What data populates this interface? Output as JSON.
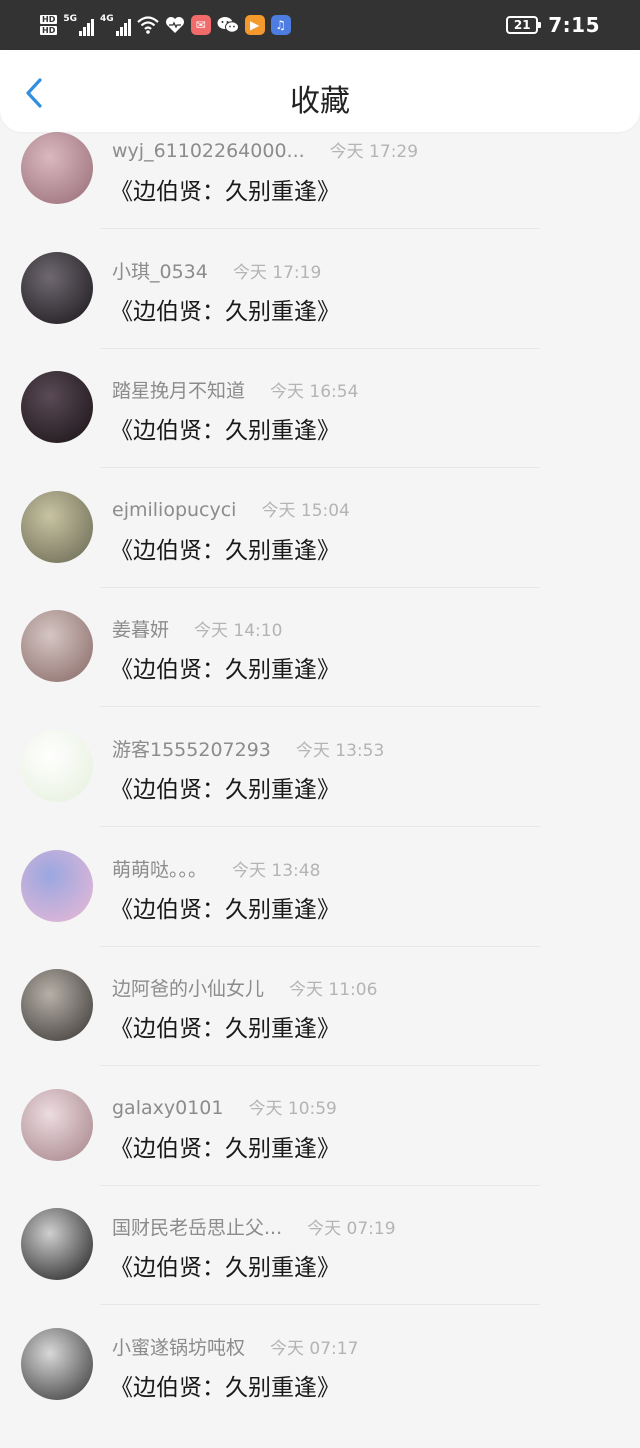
{
  "statusbar": {
    "network_gen_1": "5G",
    "network_gen_2": "4G",
    "battery": "21",
    "time": "7:15",
    "icons": [
      "hd-icon",
      "signal-icon",
      "wifi-icon",
      "heart-icon",
      "mail-app-icon",
      "wechat-icon",
      "video-app-icon",
      "music-app-icon"
    ]
  },
  "header": {
    "title": "收藏",
    "back_icon": "chevron-left-icon"
  },
  "items": [
    {
      "user": "wyj_61102264000...",
      "time": "今天 17:29",
      "title": "《边伯贤：久别重逢》",
      "avatar_colors": [
        "#d9b8bf",
        "#9a6f7a"
      ]
    },
    {
      "user": "小琪_0534",
      "time": "今天 17:19",
      "title": "《边伯贤：久别重逢》",
      "avatar_colors": [
        "#6f6870",
        "#1c1a1e"
      ]
    },
    {
      "user": "踏星挽月不知道",
      "time": "今天 16:54",
      "title": "《边伯贤：久别重逢》",
      "avatar_colors": [
        "#5a4a55",
        "#1b1418"
      ]
    },
    {
      "user": "ejmiliopucyci",
      "time": "今天 15:04",
      "title": "《边伯贤：久别重逢》",
      "avatar_colors": [
        "#c8c3a2",
        "#6b6a55"
      ]
    },
    {
      "user": "姜暮妍",
      "time": "今天 14:10",
      "title": "《边伯贤：久别重逢》",
      "avatar_colors": [
        "#d5c6c3",
        "#8a6c69"
      ]
    },
    {
      "user": "游客1555207293",
      "time": "今天 13:53",
      "title": "《边伯贤：久别重逢》",
      "avatar_colors": [
        "#ffffff",
        "#e6f0dd"
      ]
    },
    {
      "user": "萌萌哒。。。",
      "time": "今天 13:48",
      "title": "《边伯贤：久别重逢》",
      "avatar_colors": [
        "#9aa7e0",
        "#e7b8d6"
      ]
    },
    {
      "user": "边阿爸的小仙女儿",
      "time": "今天 11:06",
      "title": "《边伯贤：久别重逢》",
      "avatar_colors": [
        "#b7b0a8",
        "#3d3a38"
      ]
    },
    {
      "user": "galaxy0101",
      "time": "今天 10:59",
      "title": "《边伯贤：久别重逢》",
      "avatar_colors": [
        "#ecdce0",
        "#a7858b"
      ]
    },
    {
      "user": "国财民老岳思止父...",
      "time": "今天 07:19",
      "title": "《边伯贤：久别重逢》",
      "avatar_colors": [
        "#cfcfcf",
        "#222222"
      ]
    },
    {
      "user": "小蜜遂锅坊吨权",
      "time": "今天 07:17",
      "title": "《边伯贤：久别重逢》",
      "avatar_colors": [
        "#d8d8d8",
        "#3a3a3a"
      ]
    }
  ]
}
